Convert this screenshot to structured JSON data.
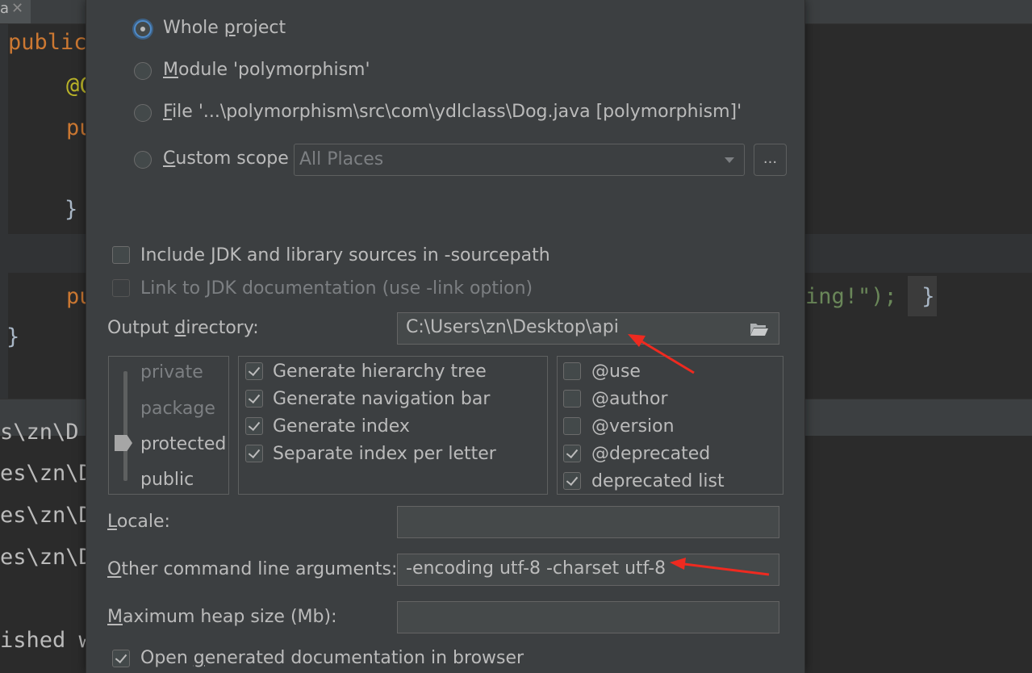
{
  "editor": {
    "tab_name": "a",
    "tab_close": "✕",
    "code_lines": [
      {
        "text": "public",
        "kind": "kw"
      },
      {
        "text": "@C",
        "kind": "ann"
      },
      {
        "text": "pu",
        "kind": "kw"
      },
      {
        "text": "}",
        "kind": "plain"
      },
      {
        "text": "pu",
        "kind": "kw"
      },
      {
        "text": "}",
        "kind": "plain"
      }
    ],
    "string_tail": "ing!\");",
    "brace_tail": " }",
    "console_lines": [
      "s\\zn\\D",
      "es\\zn\\D",
      "es\\zn\\D",
      "es\\zn\\D",
      "ished w"
    ]
  },
  "scope": {
    "options": [
      {
        "label_pre": "Whole ",
        "mnemonic": "p",
        "label_post": "roject",
        "selected": true
      },
      {
        "label_pre": "",
        "mnemonic": "M",
        "label_post": "odule 'polymorphism'",
        "selected": false
      },
      {
        "label_pre": "",
        "mnemonic": "F",
        "label_post": "ile '...\\polymorphism\\src\\com\\ydlclass\\Dog.java [polymorphism]'",
        "selected": false
      },
      {
        "label_pre": "",
        "mnemonic": "C",
        "label_post": "ustom scope",
        "selected": false
      }
    ],
    "custom_scope_value": "All Places",
    "ellipsis_label": "..."
  },
  "options": {
    "include_jdk": {
      "label": "Include JDK and library sources in -sourcepath",
      "checked": false,
      "enabled": true
    },
    "link_jdk": {
      "label": "Link to JDK documentation (use -link option)",
      "checked": false,
      "enabled": false
    }
  },
  "output": {
    "label_pre": "Output ",
    "mnemonic": "d",
    "label_post": "irectory:",
    "value": "C:\\Users\\zn\\Desktop\\api",
    "browse_icon": "folder-open-icon"
  },
  "visibility": {
    "levels": [
      "private",
      "package",
      "protected",
      "public"
    ],
    "selected": "protected"
  },
  "generate": [
    {
      "label": "Generate hierarchy tree",
      "checked": true
    },
    {
      "label": "Generate navigation bar",
      "checked": true
    },
    {
      "label": "Generate index",
      "checked": true
    },
    {
      "label": "Separate index per letter",
      "checked": true
    }
  ],
  "tags": [
    {
      "label": "@use",
      "checked": false
    },
    {
      "label": "@author",
      "checked": false
    },
    {
      "label": "@version",
      "checked": false
    },
    {
      "label": "@deprecated",
      "checked": true
    },
    {
      "label": "deprecated list",
      "checked": true
    }
  ],
  "locale": {
    "mnemonic": "L",
    "label_post": "ocale:",
    "value": ""
  },
  "other_args": {
    "mnemonic": "O",
    "label_post": "ther command line arguments:",
    "value": "-encoding utf-8 -charset utf-8"
  },
  "heap": {
    "mnemonic": "M",
    "label_post": "aximum heap size (Mb):",
    "value": ""
  },
  "open_browser": {
    "label_pre": "Open ",
    "mnemonic": "g",
    "label_post": "enerated documentation in browser",
    "checked": true
  },
  "colors": {
    "annotation_arrow": "#ee2a20",
    "radio_focus": "#4f8ac7",
    "dialog_bg": "#3c3f41"
  }
}
